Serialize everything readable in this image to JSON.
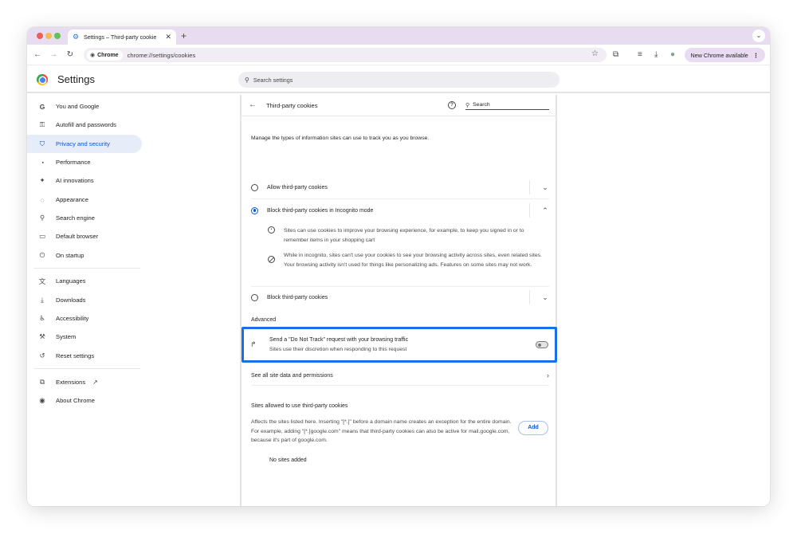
{
  "browser": {
    "tab_title": "Settings – Third-party cookie",
    "new_tab": "+",
    "url_chip": "Chrome",
    "url": "chrome://settings/cookies",
    "update_label": "New Chrome available"
  },
  "header": {
    "title": "Settings",
    "search_placeholder": "Search settings"
  },
  "sidebar": {
    "items": [
      {
        "label": "You and Google",
        "icon": "google-icon"
      },
      {
        "label": "Autofill and passwords",
        "icon": "key-icon"
      },
      {
        "label": "Privacy and security",
        "icon": "shield-icon",
        "active": true
      },
      {
        "label": "Performance",
        "icon": "speedometer-icon"
      },
      {
        "label": "AI innovations",
        "icon": "sparkle-icon"
      },
      {
        "label": "Appearance",
        "icon": "palette-icon"
      },
      {
        "label": "Search engine",
        "icon": "search-icon"
      },
      {
        "label": "Default browser",
        "icon": "browser-window-icon"
      },
      {
        "label": "On startup",
        "icon": "power-icon"
      },
      {
        "label": "Languages",
        "icon": "translate-icon"
      },
      {
        "label": "Downloads",
        "icon": "download-icon"
      },
      {
        "label": "Accessibility",
        "icon": "accessibility-icon"
      },
      {
        "label": "System",
        "icon": "wrench-icon"
      },
      {
        "label": "Reset settings",
        "icon": "reset-icon"
      },
      {
        "label": "Extensions",
        "icon": "puzzle-icon"
      },
      {
        "label": "About Chrome",
        "icon": "chrome-icon"
      }
    ]
  },
  "page": {
    "title": "Third-party cookies",
    "search_placeholder": "Search",
    "description": "Manage the types of information sites can use to track you as you browse.",
    "options": [
      {
        "label": "Allow third-party cookies",
        "selected": false,
        "expanded": false
      },
      {
        "label": "Block third-party cookies in Incognito mode",
        "selected": true,
        "expanded": true
      },
      {
        "label": "Block third-party cookies",
        "selected": false,
        "expanded": false
      }
    ],
    "incognito_details": [
      "Sites can use cookies to improve your browsing experience, for example, to keep you signed in or to remember items in your shopping cart",
      "While in incognito, sites can't use your cookies to see your browsing activity across sites, even related sites. Your browsing activity isn't used for things like personalizing ads. Features on some sites may not work."
    ],
    "advanced_label": "Advanced",
    "dnt": {
      "title": "Send a \"Do Not Track\" request with your browsing traffic",
      "subtitle": "Sites use their discretion when responding to this request",
      "enabled": false
    },
    "see_all_label": "See all site data and permissions",
    "allowed_title": "Sites allowed to use third-party cookies",
    "allowed_description": "Affects the sites listed here. Inserting \"[*.]\" before a domain name creates an exception for the entire domain. For example, adding \"[*.]google.com\" means that third-party cookies can also be active for mail.google.com, because it's part of google.com.",
    "add_label": "Add",
    "empty_label": "No sites added"
  },
  "colors": {
    "accent": "#0b57d0",
    "highlight_border": "#1a6ee8",
    "tabstrip": "#e8ddf0",
    "active_nav_bg": "#e6ecf8"
  }
}
